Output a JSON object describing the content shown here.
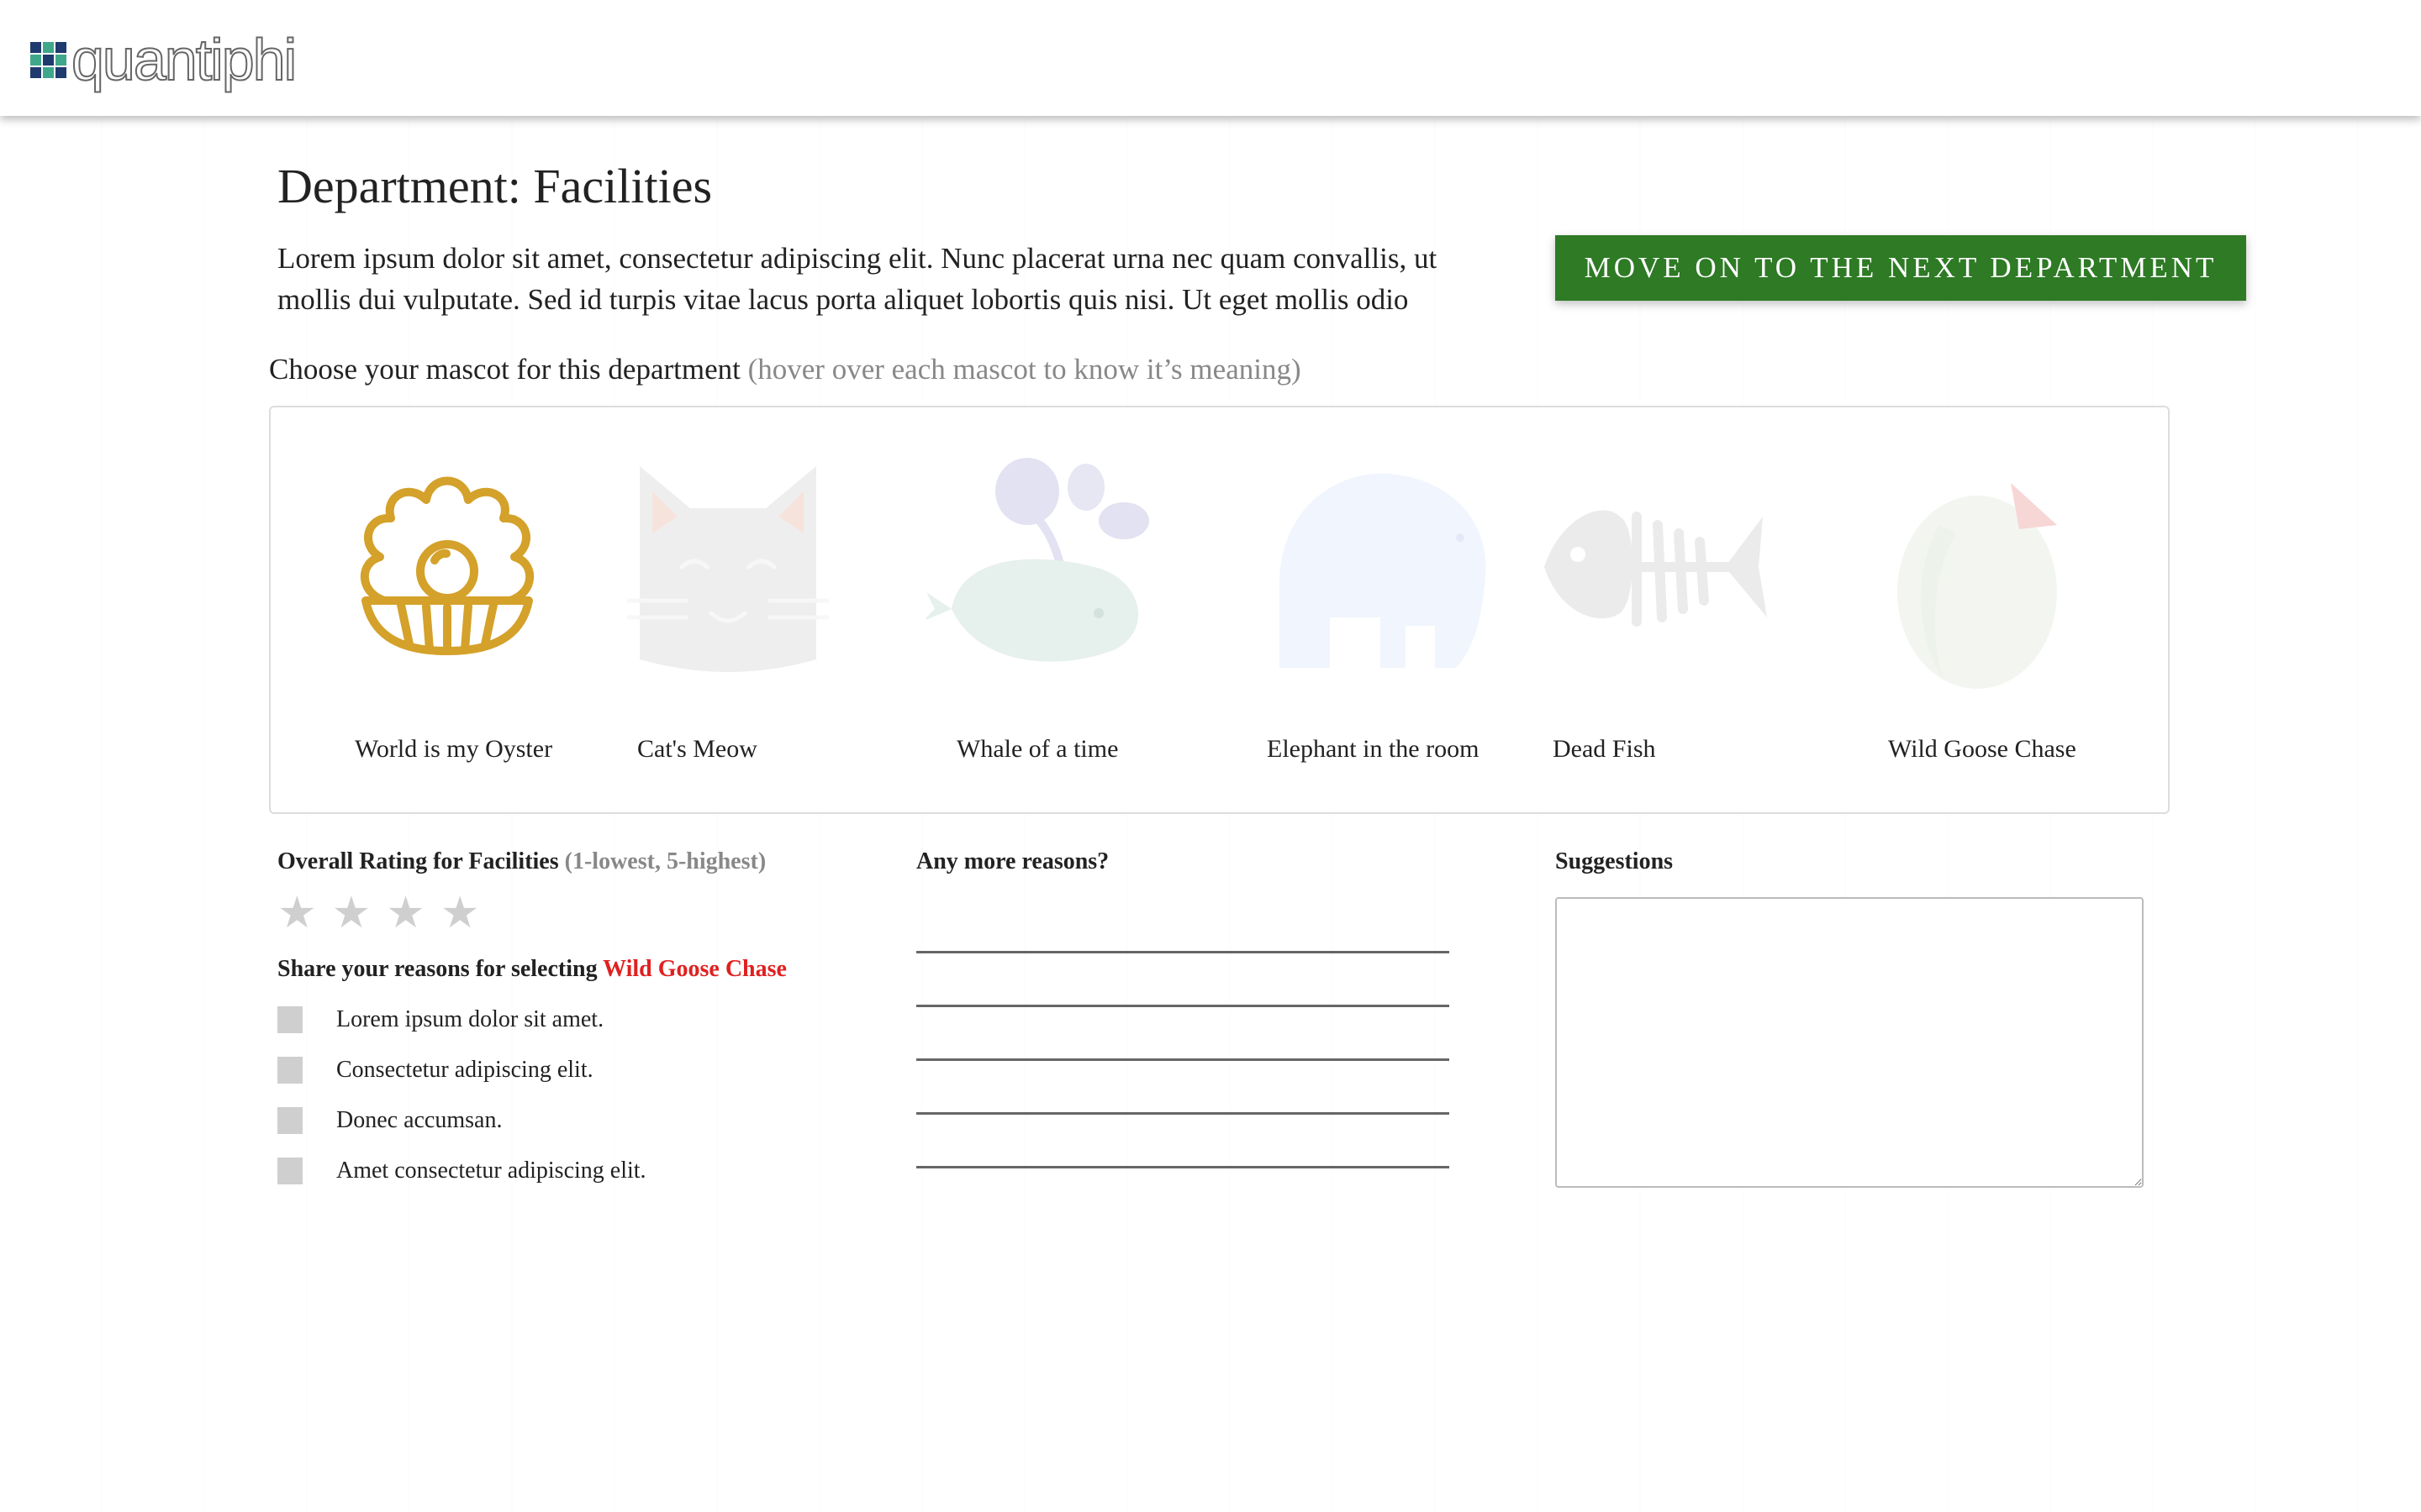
{
  "brand": {
    "name": "quantiphi",
    "logo_colors": [
      "#1f3a6e",
      "#3fa78a",
      "#1f3a6e",
      "#3fa78a",
      "#1f3a6e",
      "#3fa78a",
      "#1f3a6e",
      "#3fa78a",
      "#1f3a6e"
    ]
  },
  "header": {
    "title": "Department: Facilities",
    "description": "Lorem ipsum dolor sit amet, consectetur adipiscing elit. Nunc placerat urna nec quam convallis, ut mollis dui vulputate. Sed id turpis vitae lacus porta aliquet lobortis quis nisi. Ut eget mollis odio",
    "next_button": "MOVE ON TO THE NEXT DEPARTMENT"
  },
  "mascot_section": {
    "prompt": "Choose your mascot for this department",
    "hint": "(hover over each mascot to know it’s meaning)",
    "mascots": [
      {
        "label": "World is my Oyster",
        "icon": "oyster-pearl-icon",
        "color": "#d4a12a",
        "selected_looking": true
      },
      {
        "label": "Cat's Meow",
        "icon": "cat-face-icon",
        "color": "#eeeeee"
      },
      {
        "label": "Whale of a time",
        "icon": "whale-icon",
        "color": "#e6f0ec"
      },
      {
        "label": "Elephant in the room",
        "icon": "elephant-icon",
        "color": "#f1f5fd"
      },
      {
        "label": "Dead Fish",
        "icon": "fish-skeleton-icon",
        "color": "#ebebeb"
      },
      {
        "label": "Wild Goose Chase",
        "icon": "goose-icon",
        "color": "#f3f6f0"
      }
    ]
  },
  "rating": {
    "label": "Overall Rating for Facilities",
    "scale_hint": "(1-lowest, 5-highest)",
    "star_color": "#cfcfcf",
    "visible_stars": 4
  },
  "reasons": {
    "label_prefix": "Share your reasons for selecting",
    "selected_mascot": "Wild Goose Chase",
    "options": [
      "Lorem ipsum dolor sit amet.",
      "Consectetur adipiscing elit.",
      "Donec accumsan.",
      "Amet consectetur adipiscing elit."
    ]
  },
  "more_reasons": {
    "label": "Any more reasons?",
    "line_count": 5
  },
  "suggestions": {
    "label": "Suggestions",
    "value": ""
  },
  "colors": {
    "accent_green": "#2e7a25",
    "highlight_red": "#e02020",
    "muted": "#888888"
  }
}
